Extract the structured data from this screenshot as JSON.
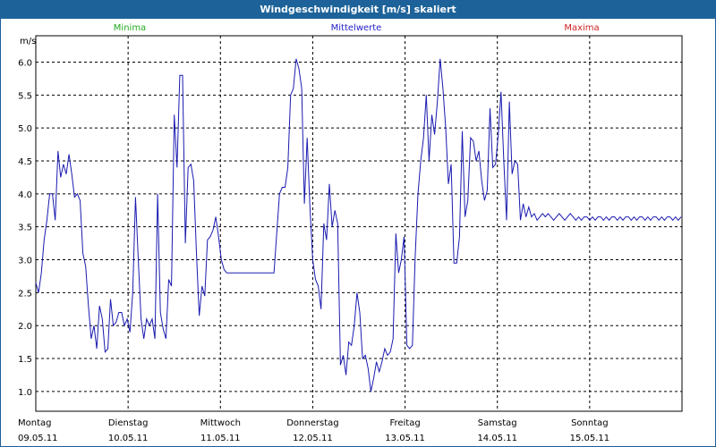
{
  "window": {
    "title": "Windgeschwindigkeit [m/s] skaliert"
  },
  "legend": {
    "minima": {
      "label": "Minima",
      "color": "#22aa22"
    },
    "mittel": {
      "label": "Mittelwerte",
      "color": "#2222cc"
    },
    "maxima": {
      "label": "Maxima",
      "color": "#cc2222"
    }
  },
  "chart_data": {
    "type": "line",
    "title": "Windgeschwindigkeit [m/s] skaliert",
    "ylabel": "m/s",
    "xlabel": "",
    "ylim": [
      0.7,
      6.4
    ],
    "yticks": [
      "1.0",
      "1.5",
      "2.0",
      "2.5",
      "3.0",
      "3.5",
      "4.0",
      "4.5",
      "5.0",
      "5.5",
      "6.0"
    ],
    "grid": true,
    "legend_position": "top",
    "xlim": [
      0,
      7
    ],
    "day_labels": [
      {
        "day": "Montag",
        "date": "09.05.11"
      },
      {
        "day": "Dienstag",
        "date": "10.05.11"
      },
      {
        "day": "Mittwoch",
        "date": "11.05.11"
      },
      {
        "day": "Donnerstag",
        "date": "12.05.11"
      },
      {
        "day": "Freitag",
        "date": "13.05.11"
      },
      {
        "day": "Samstag",
        "date": "14.05.11"
      },
      {
        "day": "Sonntag",
        "date": "15.05.11"
      }
    ],
    "series": [
      {
        "name": "Mittelwerte",
        "color": "#1a1ab0",
        "x": [
          0,
          0.03,
          0.06,
          0.09,
          0.12,
          0.15,
          0.18,
          0.21,
          0.24,
          0.27,
          0.3,
          0.33,
          0.36,
          0.39,
          0.42,
          0.45,
          0.48,
          0.51,
          0.54,
          0.57,
          0.6,
          0.63,
          0.66,
          0.69,
          0.72,
          0.75,
          0.78,
          0.81,
          0.84,
          0.87,
          0.9,
          0.93,
          0.96,
          0.99,
          1.02,
          1.05,
          1.08,
          1.11,
          1.14,
          1.17,
          1.2,
          1.23,
          1.26,
          1.29,
          1.32,
          1.35,
          1.38,
          1.41,
          1.44,
          1.47,
          1.5,
          1.53,
          1.56,
          1.59,
          1.62,
          1.65,
          1.68,
          1.71,
          1.74,
          1.77,
          1.8,
          1.83,
          1.86,
          1.89,
          1.92,
          1.95,
          1.98,
          2.01,
          2.04,
          2.07,
          2.1,
          2.13,
          2.16,
          2.19,
          2.22,
          2.25,
          2.28,
          2.31,
          2.34,
          2.37,
          2.4,
          2.43,
          2.46,
          2.49,
          2.52,
          2.55,
          2.58,
          2.61,
          2.64,
          2.67,
          2.7,
          2.73,
          2.76,
          2.79,
          2.82,
          2.85,
          2.88,
          2.91,
          2.94,
          2.97,
          3.0,
          3.03,
          3.06,
          3.09,
          3.12,
          3.15,
          3.18,
          3.21,
          3.24,
          3.27,
          3.3,
          3.33,
          3.36,
          3.39,
          3.42,
          3.45,
          3.48,
          3.51,
          3.54,
          3.57,
          3.6,
          3.63,
          3.66,
          3.69,
          3.72,
          3.75,
          3.78,
          3.81,
          3.84,
          3.87,
          3.9,
          3.93,
          3.96,
          3.99,
          4.02,
          4.05,
          4.08,
          4.11,
          4.14,
          4.17,
          4.2,
          4.23,
          4.26,
          4.29,
          4.32,
          4.35,
          4.38,
          4.41,
          4.44,
          4.47,
          4.5,
          4.53,
          4.56,
          4.59,
          4.62,
          4.65,
          4.68,
          4.71,
          4.74,
          4.77,
          4.8,
          4.83,
          4.86,
          4.89,
          4.92,
          4.95,
          4.98,
          5.01,
          5.04,
          5.07,
          5.1,
          5.13,
          5.16,
          5.19,
          5.22,
          5.25,
          5.28,
          5.31,
          5.34,
          5.37,
          5.4,
          5.43,
          5.46,
          5.49,
          5.52,
          5.55,
          5.58,
          5.61,
          5.64,
          5.67,
          5.7,
          5.73,
          5.76,
          5.79,
          5.82,
          5.85,
          5.88,
          5.91,
          5.94,
          5.97,
          6.0,
          6.03,
          6.06,
          6.09,
          6.12,
          6.15,
          6.18,
          6.21,
          6.24,
          6.27,
          6.3,
          6.33,
          6.36,
          6.39,
          6.42,
          6.45,
          6.48,
          6.51,
          6.54,
          6.57,
          6.6,
          6.63,
          6.66,
          6.69,
          6.72,
          6.75,
          6.78,
          6.81,
          6.84,
          6.87,
          6.9,
          6.93,
          6.96,
          6.99
        ],
        "values": [
          2.65,
          2.5,
          2.8,
          3.3,
          3.6,
          4.0,
          4.0,
          3.6,
          4.65,
          4.25,
          4.45,
          4.3,
          4.6,
          4.3,
          3.95,
          4.0,
          3.9,
          3.1,
          2.9,
          2.3,
          1.8,
          2.0,
          1.65,
          2.3,
          2.1,
          1.6,
          1.65,
          2.4,
          2.0,
          2.05,
          2.2,
          2.2,
          2.0,
          2.1,
          1.9,
          2.5,
          3.95,
          3.0,
          2.1,
          1.8,
          2.1,
          2.0,
          2.1,
          1.8,
          4.0,
          2.2,
          1.95,
          1.8,
          2.7,
          2.6,
          5.2,
          4.4,
          5.8,
          5.8,
          3.25,
          4.4,
          4.45,
          4.2,
          3.1,
          2.15,
          2.6,
          2.45,
          3.3,
          3.35,
          3.45,
          3.65,
          3.35,
          3.0,
          2.85,
          2.8,
          2.8,
          2.8,
          2.8,
          2.8,
          2.8,
          2.8,
          2.8,
          2.8,
          2.8,
          2.8,
          2.8,
          2.8,
          2.8,
          2.8,
          2.8,
          2.8,
          2.8,
          3.4,
          4.0,
          4.1,
          4.1,
          4.4,
          5.5,
          5.6,
          6.05,
          5.9,
          5.6,
          3.85,
          4.85,
          3.8,
          3.0,
          2.7,
          2.6,
          2.25,
          3.55,
          3.3,
          4.15,
          3.5,
          3.75,
          3.55,
          1.4,
          1.55,
          1.25,
          1.75,
          1.7,
          2.0,
          2.5,
          2.2,
          1.5,
          1.55,
          1.35,
          1.0,
          1.2,
          1.45,
          1.3,
          1.45,
          1.65,
          1.55,
          1.6,
          1.8,
          3.4,
          2.8,
          3.0,
          3.35,
          1.7,
          1.65,
          1.7,
          3.05,
          4.0,
          4.5,
          4.85,
          5.5,
          4.5,
          5.2,
          4.9,
          5.4,
          6.05,
          5.6,
          5.0,
          4.15,
          4.45,
          2.95,
          2.95,
          3.35,
          4.95,
          3.65,
          3.9,
          4.85,
          4.8,
          4.5,
          4.65,
          4.2,
          3.9,
          4.05,
          5.3,
          4.4,
          4.45,
          4.9,
          5.55,
          4.5,
          3.6,
          5.4,
          4.3,
          4.5,
          4.45,
          3.6,
          3.85,
          3.65,
          3.8,
          3.65,
          3.7,
          3.6,
          3.65,
          3.7,
          3.65,
          3.7,
          3.65,
          3.6,
          3.65,
          3.7,
          3.65,
          3.6,
          3.65,
          3.7,
          3.65,
          3.6,
          3.65,
          3.6,
          3.65,
          3.65,
          3.6,
          3.65,
          3.6,
          3.65,
          3.65,
          3.6,
          3.65,
          3.6,
          3.65,
          3.65,
          3.6,
          3.65,
          3.6,
          3.65,
          3.65,
          3.6,
          3.65,
          3.6,
          3.65,
          3.65,
          3.6,
          3.65,
          3.6,
          3.65,
          3.65,
          3.6,
          3.65,
          3.6,
          3.65,
          3.65,
          3.6,
          3.65,
          3.6,
          3.65
        ]
      }
    ]
  }
}
